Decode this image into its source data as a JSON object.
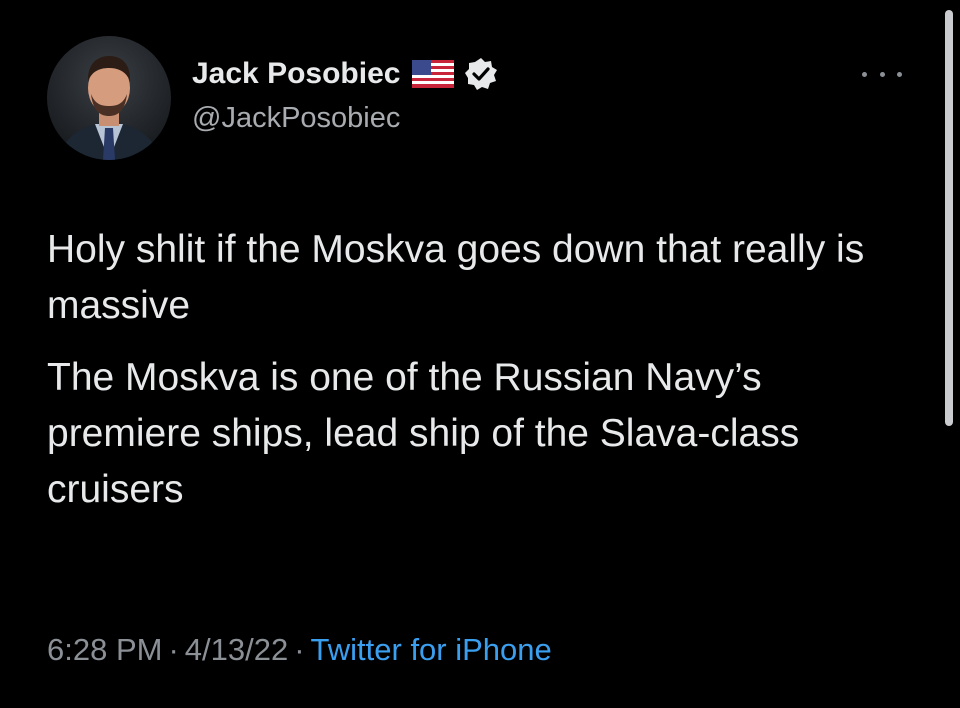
{
  "tweet": {
    "author": {
      "display_name": "Jack Posobiec",
      "handle": "@JackPosobiec",
      "flag_icon": "us-flag-icon",
      "verified_icon": "verified-badge-icon",
      "avatar_icon": "profile-photo"
    },
    "more_icon": "more-options-icon",
    "paragraphs": [
      "Holy shlit if the Moskva goes down that really is massive",
      "The Moskva is one of the Russian Navy’s premiere ships, lead ship of the Slava-class cruisers"
    ],
    "meta": {
      "time": "6:28 PM",
      "separator": "·",
      "date": "4/13/22",
      "source": "Twitter for iPhone"
    }
  },
  "colors": {
    "background": "#000000",
    "text": "#e7e9ea",
    "muted": "#8b9096",
    "link": "#3b9ff0",
    "verified": "#e7e9ea"
  }
}
